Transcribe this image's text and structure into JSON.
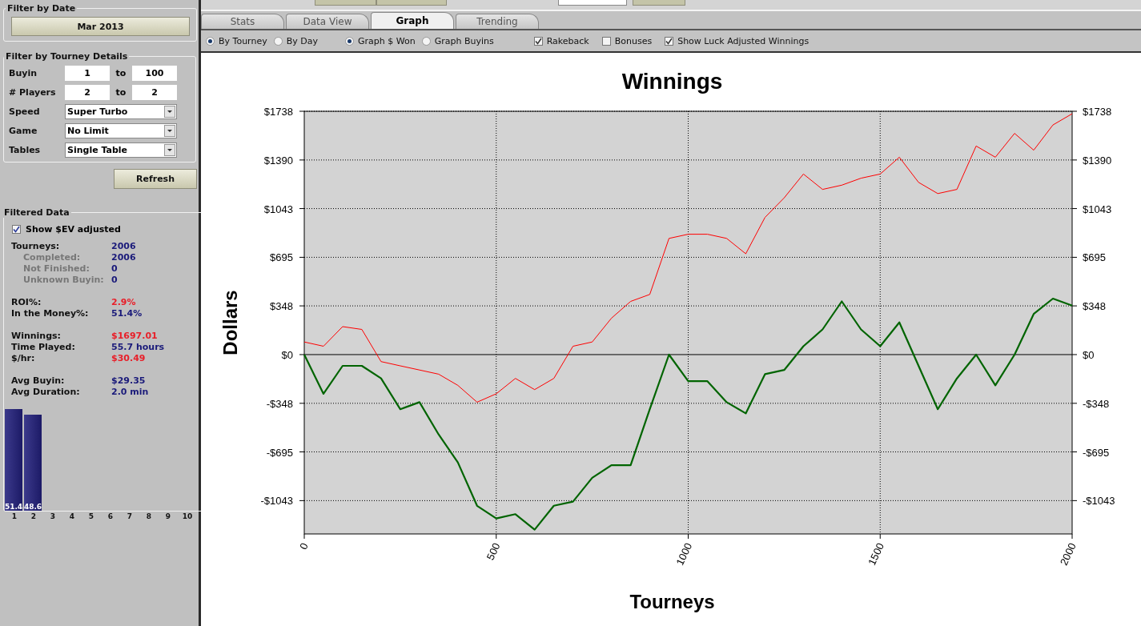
{
  "sidebar": {
    "filter_by_date": {
      "title": "Filter by Date",
      "button": "Mar 2013"
    },
    "filter_by_tourney_details": {
      "title": "Filter by Tourney Details",
      "rows": [
        {
          "kind": "range",
          "label": "Buyin",
          "from": "1",
          "to_label": "to",
          "to": "100"
        },
        {
          "kind": "range",
          "label": "# Players",
          "from": "2",
          "to_label": "to",
          "to": "2"
        },
        {
          "kind": "select",
          "label": "Speed",
          "value": "Super Turbo"
        },
        {
          "kind": "select",
          "label": "Game",
          "value": "No Limit"
        },
        {
          "kind": "select",
          "label": "Tables",
          "value": "Single Table"
        }
      ]
    },
    "refresh_button": "Refresh",
    "filtered_data": {
      "title": "Filtered Data",
      "show_ev": {
        "label": "Show $EV adjusted",
        "checked": true
      },
      "groups": [
        [
          {
            "kind": "main",
            "label": "Tourneys:",
            "value": "2006",
            "color": "#1a1a7a"
          },
          {
            "kind": "sub",
            "label": "Completed:",
            "value": "2006",
            "color": "#1a1a7a"
          },
          {
            "kind": "sub",
            "label": "Not Finished:",
            "value": "0",
            "color": "#1a1a7a"
          },
          {
            "kind": "sub",
            "label": "Unknown Buyin:",
            "value": "0",
            "color": "#1a1a7a"
          }
        ],
        [
          {
            "kind": "main",
            "label": "ROI%:",
            "value": "2.9%",
            "color": "#e8202a"
          },
          {
            "kind": "main",
            "label": "In the Money%:",
            "value": "51.4%",
            "color": "#1a1a7a"
          }
        ],
        [
          {
            "kind": "main",
            "label": "Winnings:",
            "value": "$1697.01",
            "color": "#e8202a"
          },
          {
            "kind": "main",
            "label": "Time Played:",
            "value": "55.7 hours",
            "color": "#1a1a7a"
          },
          {
            "kind": "main",
            "label": "$/hr:",
            "value": "$30.49",
            "color": "#e8202a"
          }
        ],
        [
          {
            "kind": "main",
            "label": "Avg Buyin:",
            "value": "$29.35",
            "color": "#1a1a7a"
          },
          {
            "kind": "main",
            "label": "Avg Duration:",
            "value": "2.0 min",
            "color": "#1a1a7a"
          }
        ]
      ],
      "chart_data": {
        "type": "bar",
        "categories": [
          "1",
          "2",
          "3",
          "4",
          "5",
          "6",
          "7",
          "8",
          "9",
          "10"
        ],
        "values": [
          51.4,
          48.6,
          null,
          null,
          null,
          null,
          null,
          null,
          null,
          null
        ],
        "data_labels": true
      }
    }
  },
  "tabs": [
    {
      "label": "Stats",
      "selected": false
    },
    {
      "label": "Data View",
      "selected": false
    },
    {
      "label": "Graph",
      "selected": true
    },
    {
      "label": "Trending",
      "selected": false
    }
  ],
  "options": {
    "radio_groups": [
      [
        {
          "label": "By Tourney",
          "selected": true
        },
        {
          "label": "By Day",
          "selected": false
        }
      ],
      [
        {
          "label": "Graph $ Won",
          "selected": true
        },
        {
          "label": "Graph Buyins",
          "selected": false
        }
      ]
    ],
    "checkboxes": [
      {
        "label": "Rakeback",
        "checked": true
      },
      {
        "label": "Bonuses",
        "checked": false
      },
      {
        "label": "Show Luck Adjusted Winnings",
        "checked": true
      }
    ]
  },
  "chart_data": {
    "type": "line",
    "title": "Winnings",
    "xlabel": "Tourneys",
    "ylabel": "Dollars",
    "x": [
      0,
      50,
      100,
      150,
      200,
      250,
      300,
      350,
      400,
      450,
      500,
      550,
      600,
      650,
      700,
      750,
      800,
      850,
      900,
      950,
      1000,
      1050,
      1100,
      1150,
      1200,
      1250,
      1300,
      1350,
      1400,
      1450,
      1500,
      1550,
      1600,
      1650,
      1700,
      1750,
      1800,
      1850,
      1900,
      1950,
      2000
    ],
    "series": [
      {
        "color": "#ff0000",
        "values": [
          90,
          60,
          200,
          180,
          -50,
          -80,
          -110,
          -140,
          -220,
          -340,
          -280,
          -170,
          -250,
          -170,
          60,
          90,
          260,
          380,
          430,
          830,
          860,
          860,
          830,
          720,
          980,
          1120,
          1290,
          1180,
          1210,
          1260,
          1290,
          1410,
          1230,
          1150,
          1180,
          1490,
          1410,
          1580,
          1460,
          1640,
          1720
        ]
      },
      {
        "color": "#006400",
        "values": [
          0,
          -280,
          -80,
          -80,
          -170,
          -390,
          -340,
          -570,
          -770,
          -1080,
          -1170,
          -1140,
          -1250,
          -1080,
          -1050,
          -880,
          -790,
          -790,
          -390,
          0,
          -190,
          -190,
          -340,
          -420,
          -140,
          -110,
          60,
          180,
          380,
          180,
          60,
          230,
          -80,
          -390,
          -170,
          0,
          -220,
          0,
          290,
          400,
          350
        ]
      }
    ],
    "grid": true,
    "xlim": [
      0,
      2000
    ],
    "ylim": [
      -1281,
      1738
    ],
    "xticks": [
      0,
      500,
      1000,
      1500,
      2000
    ],
    "yticks": [
      {
        "value": 1738,
        "label": "$1738"
      },
      {
        "value": 1390,
        "label": "$1390"
      },
      {
        "value": 1043,
        "label": "$1043"
      },
      {
        "value": 695,
        "label": "$695"
      },
      {
        "value": 348,
        "label": "$348"
      },
      {
        "value": 0,
        "label": "$0"
      },
      {
        "value": -348,
        "label": "-$348"
      },
      {
        "value": -695,
        "label": "-$695"
      },
      {
        "value": -1043,
        "label": "-$1043"
      }
    ]
  }
}
